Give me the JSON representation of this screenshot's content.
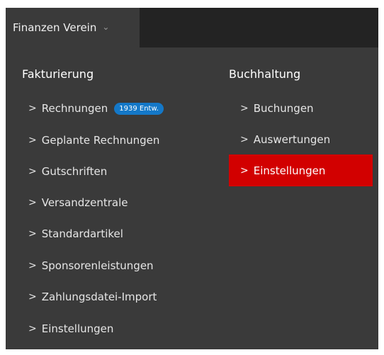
{
  "topbar": {
    "tab_label": "Finanzen Verein",
    "tab_chevron": "⌄"
  },
  "columns": {
    "fakturierung": {
      "heading": "Fakturierung",
      "items": [
        {
          "label": "Rechnungen",
          "badge": "1939 Entw."
        },
        {
          "label": "Geplante Rechnungen"
        },
        {
          "label": "Gutschriften"
        },
        {
          "label": "Versandzentrale"
        },
        {
          "label": "Standardartikel"
        },
        {
          "label": "Sponsorenleistungen"
        },
        {
          "label": "Zahlungsdatei-Import"
        },
        {
          "label": "Einstellungen"
        }
      ]
    },
    "buchhaltung": {
      "heading": "Buchhaltung",
      "items": [
        {
          "label": "Buchungen"
        },
        {
          "label": "Auswertungen"
        },
        {
          "label": "Einstellungen",
          "active": true
        }
      ]
    }
  },
  "arrow_glyph": ">",
  "colors": {
    "topbar_bg": "#232323",
    "panel_bg": "#3a3a3a",
    "active_bg": "#d20000",
    "badge_bg": "#1478c8"
  }
}
